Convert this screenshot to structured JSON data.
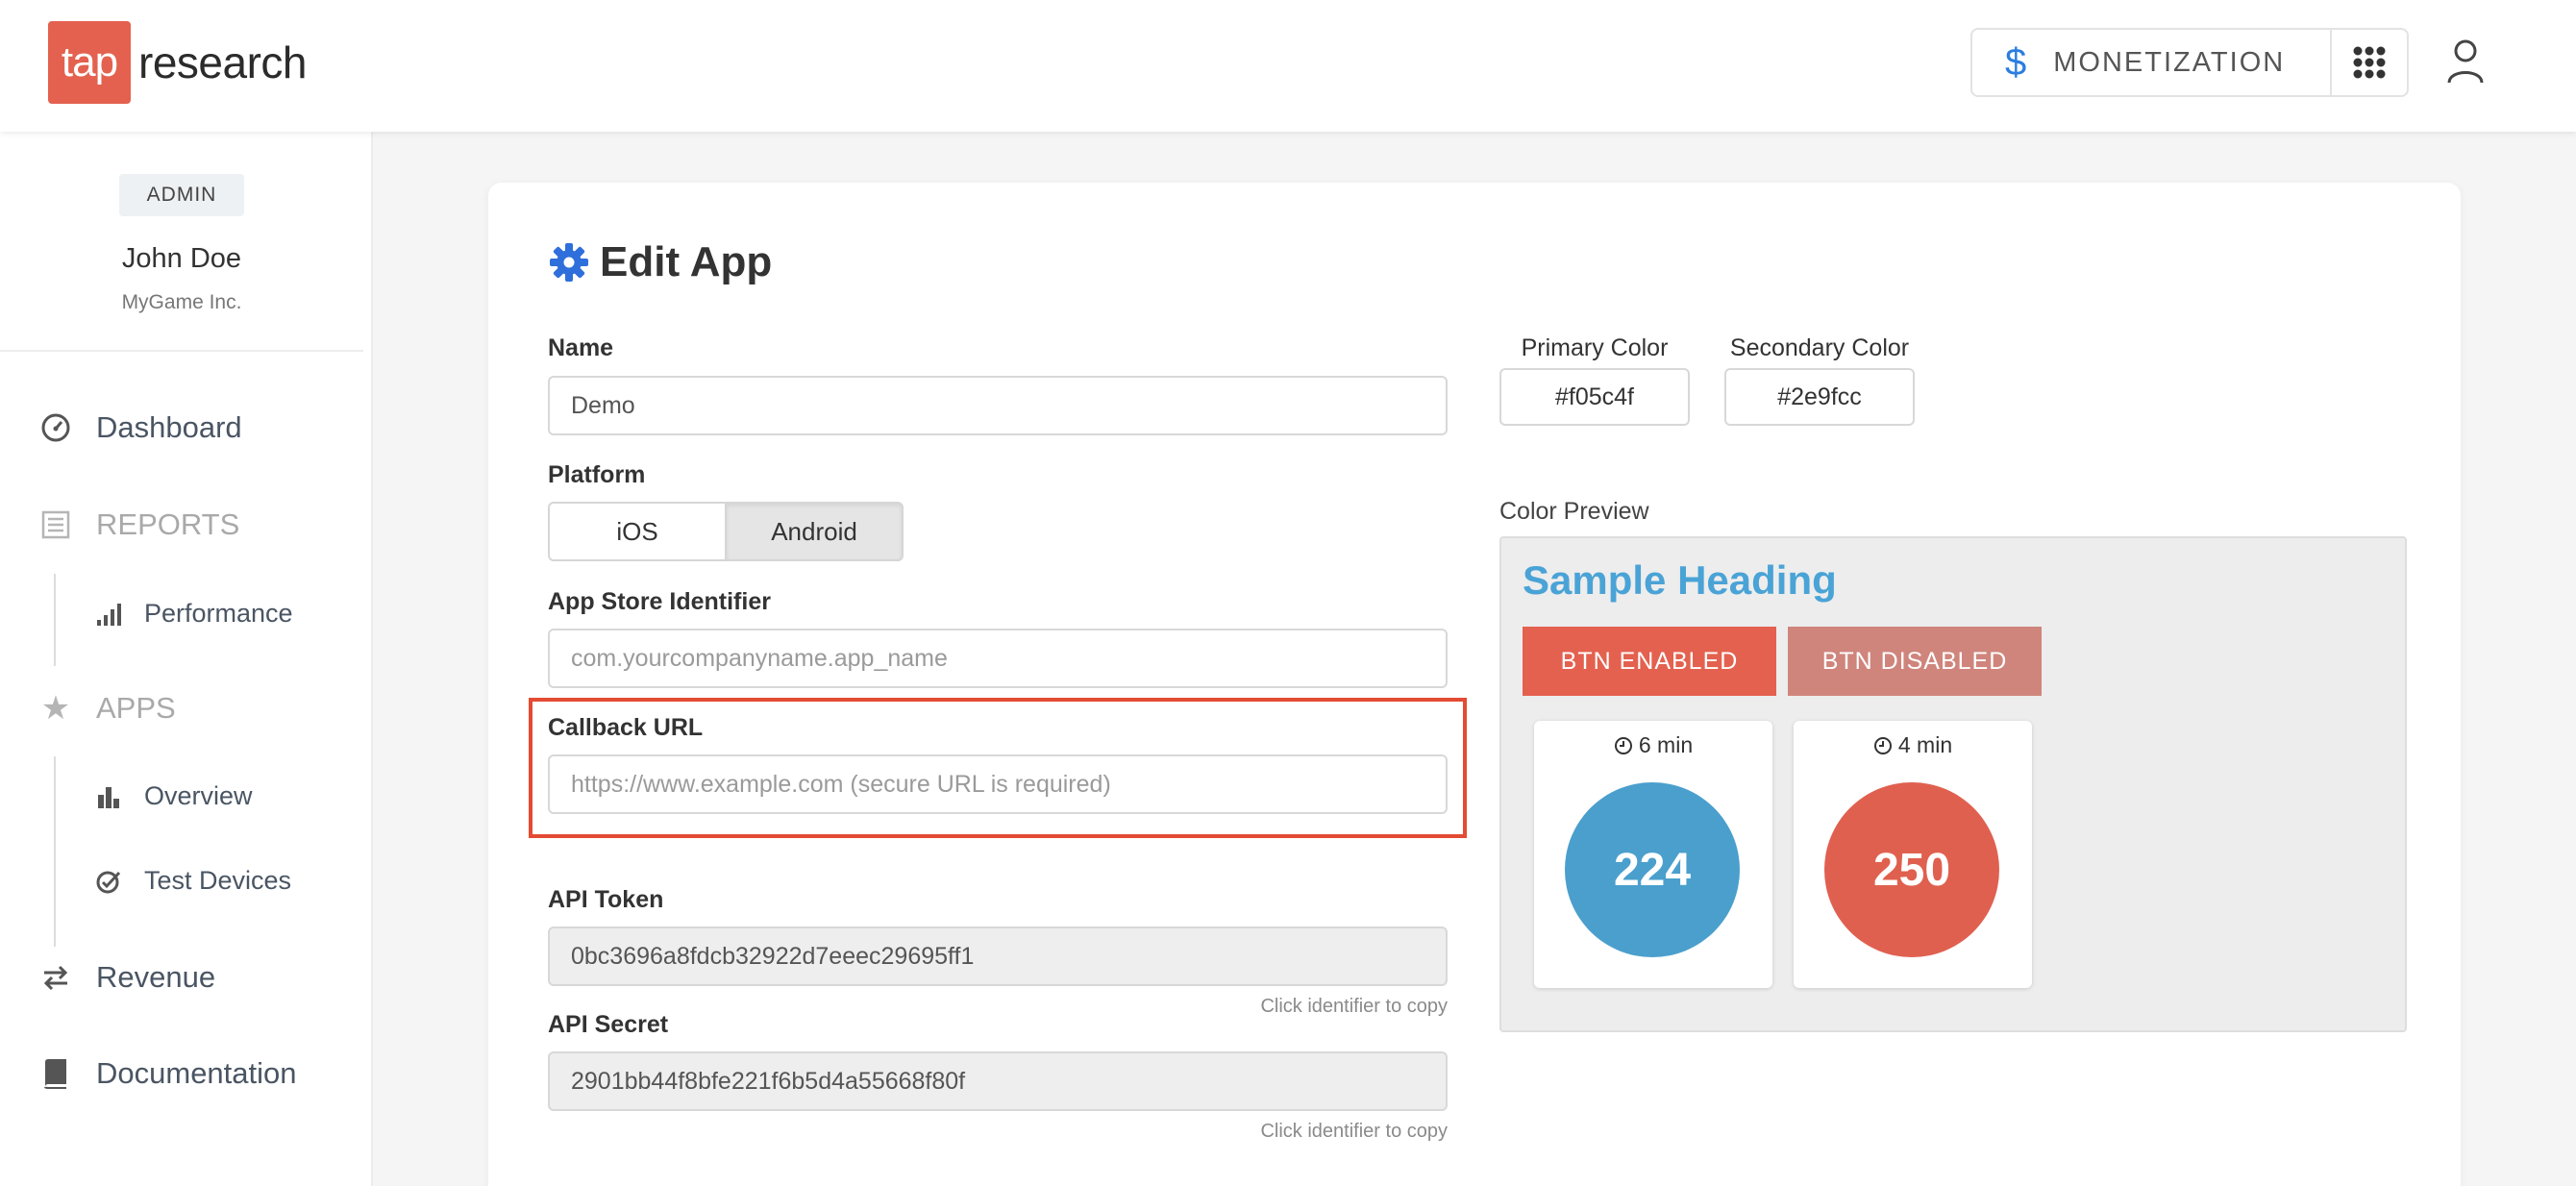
{
  "header": {
    "logo_mark": "tap",
    "logo_word": "research",
    "monetization_label": "MONETIZATION",
    "dollar_glyph": "$"
  },
  "sidebar": {
    "role_badge": "ADMIN",
    "user_name": "John Doe",
    "org": "MyGame Inc.",
    "items": [
      {
        "label": "Dashboard",
        "icon": "dashboard-gauge-icon"
      },
      {
        "label": "REPORTS",
        "icon": "reports-list-icon"
      },
      {
        "label": "Performance",
        "icon": "signal-bars-icon"
      },
      {
        "label": "APPS",
        "icon": "star-icon"
      },
      {
        "label": "Overview",
        "icon": "bar-chart-icon"
      },
      {
        "label": "Test Devices",
        "icon": "check-badge-icon"
      },
      {
        "label": "Revenue",
        "icon": "exchange-arrows-icon"
      },
      {
        "label": "Documentation",
        "icon": "book-icon"
      }
    ]
  },
  "form": {
    "title": "Edit App",
    "name_label": "Name",
    "name_value": "Demo",
    "platform_label": "Platform",
    "platform_options": [
      "iOS",
      "Android"
    ],
    "platform_selected": "Android",
    "store_id_label": "App Store Identifier",
    "store_id_placeholder": "com.yourcompanyname.app_name",
    "callback_label": "Callback URL",
    "callback_placeholder": "https://www.example.com (secure URL is required)",
    "api_token_label": "API Token",
    "api_token_value": "0bc3696a8fdcb32922d7eeec29695ff1",
    "api_secret_label": "API Secret",
    "api_secret_value": "2901bb44f8bfe221f6b5d4a55668f80f",
    "copy_hint": "Click identifier to copy"
  },
  "colors": {
    "primary_label": "Primary Color",
    "primary_value": "#f05c4f",
    "secondary_label": "Secondary Color",
    "secondary_value": "#2e9fcc",
    "preview_label": "Color Preview",
    "sample_heading": "Sample Heading",
    "btn_enabled": "BTN ENABLED",
    "btn_disabled": "BTN DISABLED",
    "tiles": [
      {
        "time": "6 min",
        "value": "224",
        "color": "#4a9fcd"
      },
      {
        "time": "4 min",
        "value": "250",
        "color": "#e0604f"
      }
    ],
    "accent_red": "#e4614f",
    "disabled_red": "#cf857c",
    "highlight": "#e34b33"
  }
}
